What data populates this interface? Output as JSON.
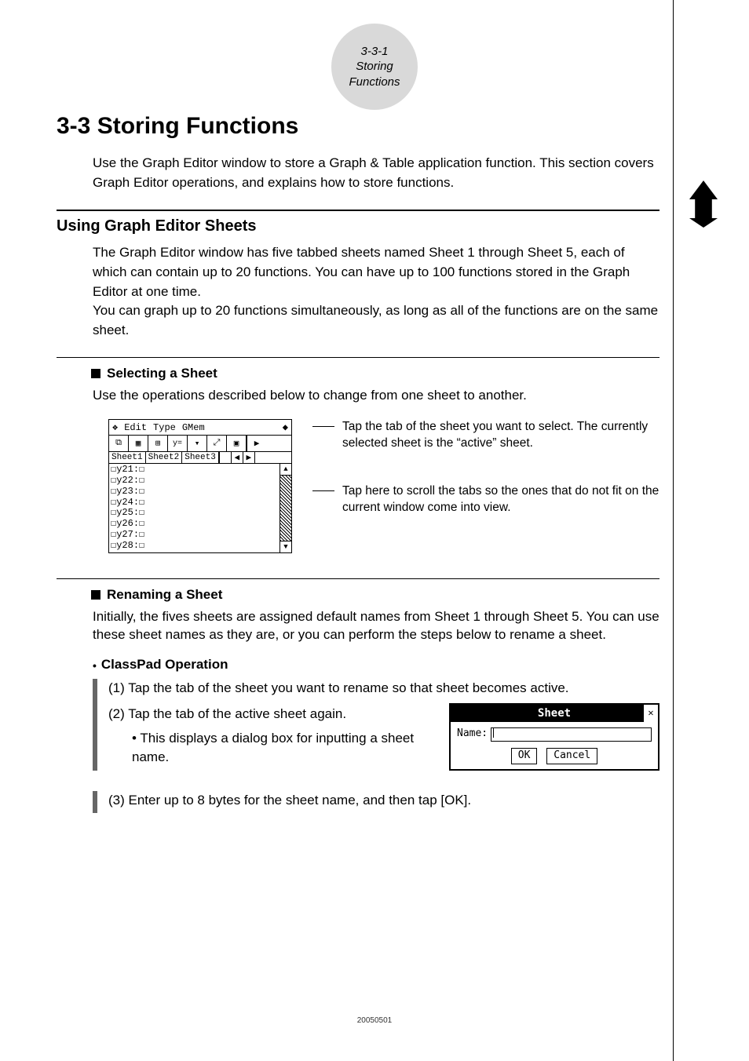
{
  "header": {
    "section_num": "3-3-1",
    "section_title_small": "Storing Functions"
  },
  "h1": "3-3  Storing Functions",
  "intro": "Use the Graph Editor window to store a Graph & Table application function. This section covers Graph Editor operations, and explains how to store functions.",
  "h2": "Using Graph Editor Sheets",
  "sheets_para": "The Graph Editor window has five tabbed sheets named Sheet 1 through Sheet 5, each of which can contain up to 20 functions. You can have up to 100 functions stored in the Graph Editor at one time.\nYou can graph up to 20 functions simultaneously, as long as all of the functions are on the same sheet.",
  "h3_select": "Selecting a Sheet",
  "select_para": "Use the operations described below to change from one sheet to another.",
  "callout_tab": "Tap the tab of the sheet you want to select. The currently selected sheet is the “active” sheet.",
  "callout_scroll": "Tap here to scroll the tabs so the ones that do not fit on the current window come into view.",
  "graph_editor": {
    "menu_items": [
      "Edit",
      "Type",
      "GMem"
    ],
    "tabs": [
      "Sheet1",
      "Sheet2",
      "Sheet3"
    ],
    "rows": [
      "y21:",
      "y22:",
      "y23:",
      "y24:",
      "y25:",
      "y26:",
      "y27:",
      "y28:"
    ]
  },
  "h3_rename": "Renaming a Sheet",
  "rename_para": "Initially, the fives sheets are assigned default names from Sheet 1 through Sheet 5. You can use these sheet names as they are, or you can perform the steps below to rename a sheet.",
  "op_heading": "ClassPad Operation",
  "steps": {
    "s1": "(1) Tap the tab of the sheet you want to rename so that sheet becomes active.",
    "s2": "(2) Tap the tab of the active sheet again.",
    "s2b": "This displays a dialog box for inputting a sheet name.",
    "s3": "(3) Enter up to 8 bytes for the sheet name, and then tap [OK]."
  },
  "dialog": {
    "title": "Sheet",
    "name_label": "Name:",
    "name_value": "",
    "ok": "OK",
    "cancel": "Cancel"
  },
  "footer": "20050501"
}
